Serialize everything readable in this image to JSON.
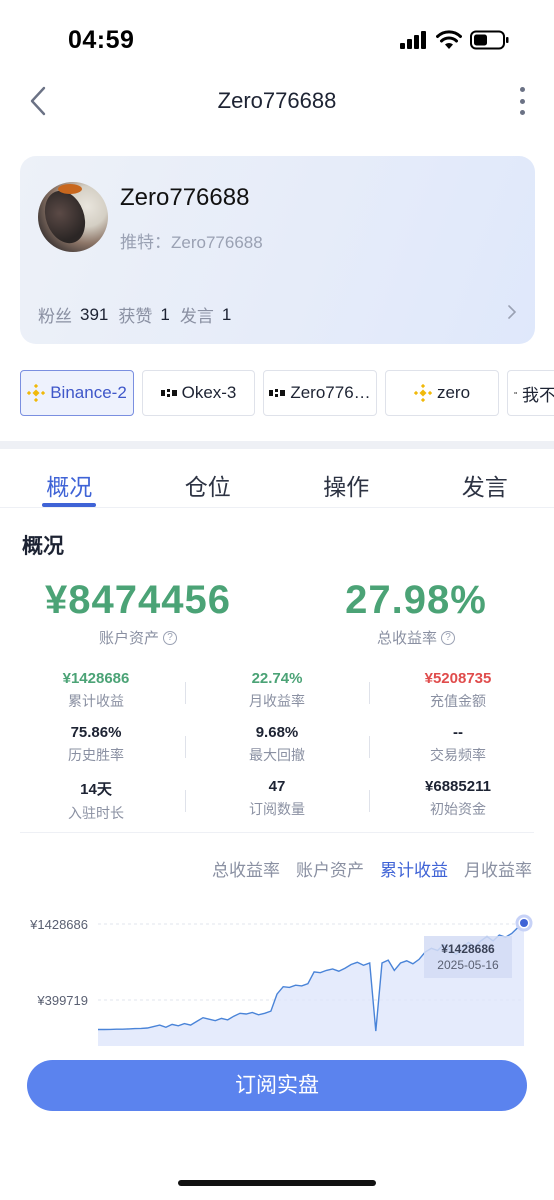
{
  "status": {
    "time": "04:59"
  },
  "nav": {
    "title": "Zero776688"
  },
  "profile": {
    "name": "Zero776688",
    "twitter": "推特：Zero776688",
    "fans_label": "粉丝",
    "fans": "391",
    "likes_label": "获赞",
    "likes": "1",
    "posts_label": "发言",
    "posts": "1"
  },
  "exchanges": [
    {
      "label": "Binance-2",
      "icon": "binance-icon"
    },
    {
      "label": "Okex-3",
      "icon": "okx-icon"
    },
    {
      "label": "Zero776…",
      "icon": "okx-icon"
    },
    {
      "label": "zero",
      "icon": "binance-icon"
    },
    {
      "label": "我不",
      "icon": "okx-icon"
    }
  ],
  "tabs": [
    "概况",
    "仓位",
    "操作",
    "发言"
  ],
  "overview": {
    "title": "概况",
    "assets_value": "¥8474456",
    "assets_label": "账户资产",
    "return_value": "27.98%",
    "return_label": "总收益率"
  },
  "stats": [
    {
      "value": "¥1428686",
      "label": "累计收益",
      "color": "green"
    },
    {
      "value": "22.74%",
      "label": "月收益率",
      "color": "green"
    },
    {
      "value": "¥5208735",
      "label": "充值金额",
      "color": "red"
    },
    {
      "value": "75.86%",
      "label": "历史胜率",
      "color": "dark"
    },
    {
      "value": "9.68%",
      "label": "最大回撤",
      "color": "dark"
    },
    {
      "value": "--",
      "label": "交易频率",
      "color": "dark"
    },
    {
      "value": "14天",
      "label": "入驻时长",
      "color": "dark"
    },
    {
      "value": "47",
      "label": "订阅数量",
      "color": "dark"
    },
    {
      "value": "¥6885211",
      "label": "初始资金",
      "color": "dark"
    }
  ],
  "chart_tabs": [
    "总收益率",
    "账户资产",
    "累计收益",
    "月收益率"
  ],
  "chart_tab_active": 2,
  "chart_data": {
    "type": "area",
    "y_ticks": [
      "¥1428686",
      "¥399719"
    ],
    "ylim": [
      -60000,
      1428686
    ],
    "tooltip": {
      "value": "¥1428686",
      "date": "2025-05-16"
    },
    "line_color": "#4a84d8",
    "fill_color": "#dfe6fb",
    "values": [
      0,
      0,
      2000,
      5000,
      4000,
      8000,
      12000,
      15000,
      20000,
      40000,
      60000,
      30000,
      70000,
      50000,
      80000,
      60000,
      110000,
      160000,
      140000,
      120000,
      150000,
      130000,
      180000,
      220000,
      210000,
      230000,
      200000,
      220000,
      250000,
      480000,
      580000,
      570000,
      600000,
      590000,
      620000,
      780000,
      770000,
      800000,
      820000,
      790000,
      830000,
      880000,
      910000,
      870000,
      900000,
      -20000,
      900000,
      940000,
      800000,
      900000,
      930000,
      890000,
      950000,
      1050000,
      1100000,
      1070000,
      1150000,
      1080000,
      1020000,
      1100000,
      1180000,
      1120000,
      1200000,
      1260000,
      1200000,
      1280000,
      1250000,
      1300000,
      1380000,
      1428686
    ]
  },
  "subscribe_label": "订阅实盘",
  "colors": {
    "accent": "#3f63d6",
    "green": "#4ba376",
    "red": "#e04c4c",
    "button": "#5b83ee"
  }
}
